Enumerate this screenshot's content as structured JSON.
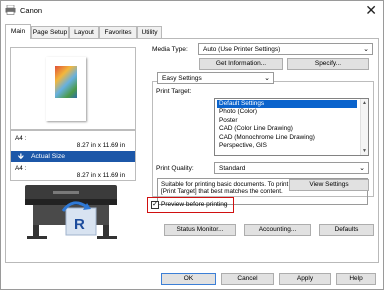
{
  "window": {
    "title": "Canon",
    "close_glyph": "✕"
  },
  "tabs": [
    {
      "label": "Main"
    },
    {
      "label": "Page Setup"
    },
    {
      "label": "Layout"
    },
    {
      "label": "Favorites"
    },
    {
      "label": "Utility"
    }
  ],
  "left": {
    "size_rows": [
      {
        "label": "A4 :",
        "value": "8.27 in x 11.69 in"
      },
      {
        "label": "A4 :",
        "value": "8.27 in x 11.69 in"
      }
    ],
    "actual_size_label": "Actual Size",
    "arrow_glyph": "🡻"
  },
  "media": {
    "label": "Media Type:",
    "value": "Auto (Use Printer Settings)",
    "get_info": "Get Information...",
    "specify": "Specify..."
  },
  "easy": {
    "value": "Easy Settings"
  },
  "target": {
    "label": "Print Target:",
    "items": [
      "Default Settings",
      "Photo (Color)",
      "Poster",
      "CAD (Color Line Drawing)",
      "CAD (Monochrome Line Drawing)",
      "Perspective, GIS"
    ],
    "selected": 0
  },
  "quality": {
    "label": "Print Quality:",
    "value": "Standard",
    "description": "Suitable for printing basic documents. To print other items, select the [Print Target] that best matches the content.",
    "view_settings": "View Settings"
  },
  "preview": {
    "label": "Preview before printing",
    "checked": true,
    "check_glyph": "✓"
  },
  "footer": {
    "status_monitor": "Status Monitor...",
    "accounting": "Accounting...",
    "defaults": "Defaults",
    "ok": "OK",
    "cancel": "Cancel",
    "apply": "Apply",
    "help": "Help"
  }
}
